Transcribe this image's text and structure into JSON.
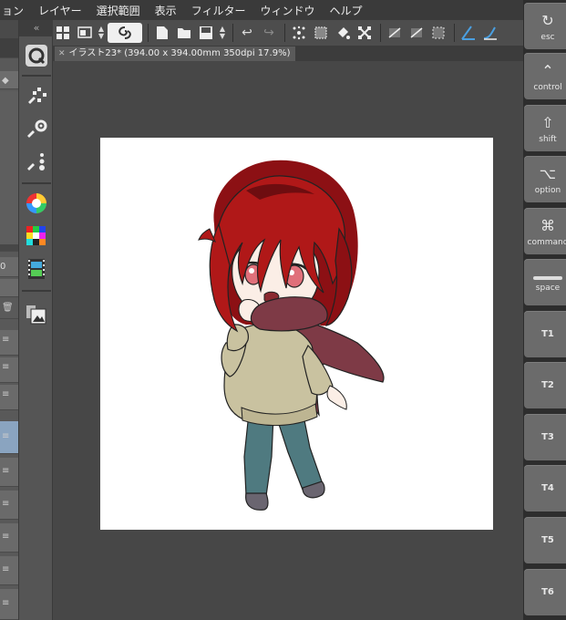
{
  "menu": [
    "ョン",
    "レイヤー",
    "選択範囲",
    "表示",
    "フィルター",
    "ウィンドウ",
    "ヘルプ"
  ],
  "tab": {
    "close": "✕",
    "title": "イラスト23* (394.00 x 394.00mm 350dpi 17.9%)"
  },
  "left_panel": {
    "value_label": "0"
  },
  "keys": [
    {
      "symbol": "↻",
      "label": "esc"
    },
    {
      "symbol": "⌃",
      "label": "control"
    },
    {
      "symbol": "⇧",
      "label": "shift"
    },
    {
      "symbol": "⌥",
      "label": "option"
    },
    {
      "symbol": "⌘",
      "label": "command"
    },
    {
      "symbol": "",
      "label": "space"
    },
    {
      "label": "T1"
    },
    {
      "label": "T2"
    },
    {
      "label": "T3"
    },
    {
      "label": "T4"
    },
    {
      "label": "T5"
    },
    {
      "label": "T6"
    }
  ],
  "colors": {
    "hair": "#b01818",
    "hair_dark": "#6e0d10",
    "skin": "#fbeee6",
    "scarf": "#7e3a46",
    "sweater": "#c9c2a0",
    "pants": "#4f7a80",
    "shoes": "#6a6570",
    "eyes": "#e0707a"
  }
}
